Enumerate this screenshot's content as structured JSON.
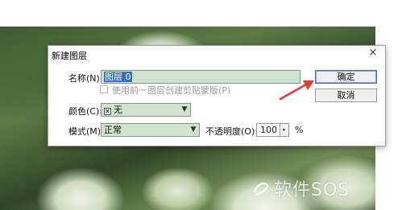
{
  "dialog": {
    "title": "新建图层",
    "close_icon": "×",
    "name_label": "名称(N):",
    "name_value": "图层 0",
    "clip_checkbox_label": "使用前一图层创建剪贴蒙版(P)",
    "clip_checked": false,
    "color_label": "颜色(C):",
    "color_value": "无",
    "color_swatch_glyph": "✕",
    "mode_label": "模式(M):",
    "mode_value": "正常",
    "opacity_label": "不透明度(O):",
    "opacity_value": "100",
    "opacity_unit": "%",
    "ok_label": "确定",
    "cancel_label": "取消"
  },
  "watermark": {
    "text": "软件SOS"
  },
  "colors": {
    "field_bg": "#cfe3cf",
    "selection": "#2f6fce",
    "arrow": "#e53935"
  },
  "icons": [
    "close-icon",
    "chevron-down-icon",
    "stepper-arrow-icon",
    "color-none-icon",
    "red-arrow-annotation",
    "watermark-logo-icon"
  ]
}
